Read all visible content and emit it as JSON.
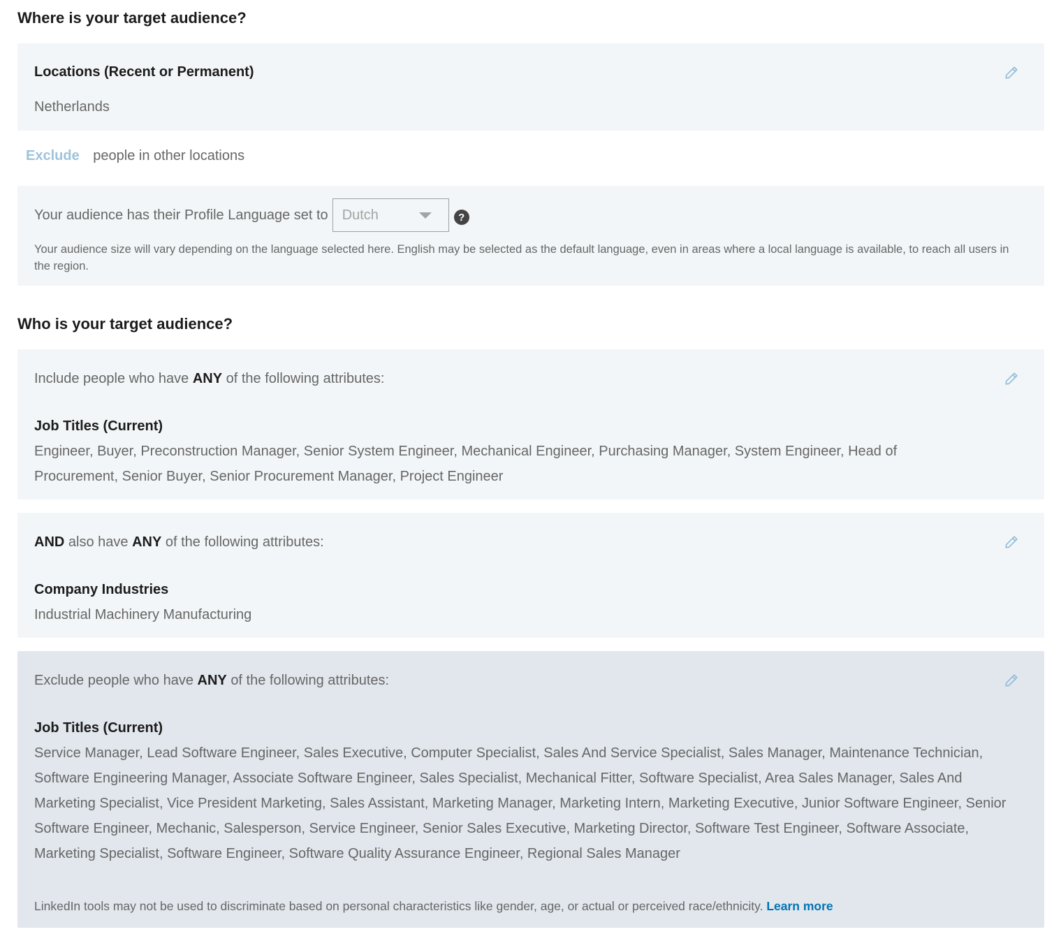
{
  "where": {
    "heading": "Where is your target audience?",
    "locations_label": "Locations (Recent or Permanent)",
    "locations_value": "Netherlands",
    "exclude_link": "Exclude",
    "exclude_text": "people in other locations",
    "language_prompt": "Your audience has their Profile Language set to",
    "language_selected": "Dutch",
    "language_note": "Your audience size will vary depending on the language selected here. English may be selected as the default language, even in areas where a local language is available, to reach all users in the region."
  },
  "who": {
    "heading": "Who is your target audience?",
    "include": {
      "prefix": "Include people who have",
      "any": "ANY",
      "suffix": "of the following attributes:",
      "facet": "Job Titles (Current)",
      "values": "Engineer, Buyer, Preconstruction Manager, Senior System Engineer, Mechanical Engineer, Purchasing Manager, System Engineer, Head of Procurement, Senior Buyer, Senior Procurement Manager, Project Engineer"
    },
    "and_also": {
      "and": "AND",
      "middle": "also have",
      "any": "ANY",
      "suffix": "of the following attributes:",
      "facet": "Company Industries",
      "values": "Industrial Machinery Manufacturing"
    },
    "exclude": {
      "prefix": "Exclude people who have",
      "any": "ANY",
      "suffix": "of the following attributes:",
      "facet": "Job Titles (Current)",
      "values": "Service Manager, Lead Software Engineer, Sales Executive, Computer Specialist, Sales And Service Specialist, Sales Manager, Maintenance Technician, Software Engineering Manager, Associate Software Engineer, Sales Specialist, Mechanical Fitter, Software Specialist, Area Sales Manager, Sales And Marketing Specialist, Vice President Marketing, Sales Assistant, Marketing Manager, Marketing Intern, Marketing Executive, Junior Software Engineer, Senior Software Engineer, Mechanic, Salesperson, Service Engineer, Senior Sales Executive, Marketing Director, Software Test Engineer, Software Associate, Marketing Specialist, Software Engineer, Software Quality Assurance Engineer, Regional Sales Manager"
    },
    "disclaimer": "LinkedIn tools may not be used to discriminate based on personal characteristics like gender, age, or actual or perceived race/ethnicity.",
    "learn_more": "Learn more"
  },
  "colors": {
    "panel_bg": "#f3f6f8",
    "panel_dark_bg": "#e1e7ed",
    "link_blue": "#0073b1",
    "light_link": "#9dc3dc",
    "edit_icon": "#8fbcdb"
  },
  "icons": {
    "edit": "pencil-icon",
    "help": "question-circle-icon",
    "dropdown": "caret-down-icon"
  }
}
